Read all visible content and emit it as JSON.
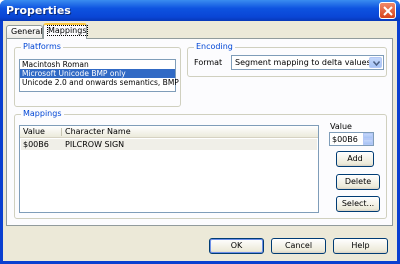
{
  "window": {
    "title": "Properties"
  },
  "tabs": [
    {
      "label": "General"
    },
    {
      "label": "Mappings"
    }
  ],
  "platforms": {
    "label": "Platforms",
    "items": [
      {
        "label": "Macintosh Roman"
      },
      {
        "label": "Microsoft Unicode BMP only"
      },
      {
        "label": "Unicode 2.0 and onwards semantics, BMP"
      }
    ],
    "selected_index": 1
  },
  "encoding": {
    "label": "Encoding",
    "format_label": "Format",
    "format_value": "Segment mapping to delta values"
  },
  "mappings": {
    "label": "Mappings",
    "columns": [
      "Value",
      "Character Name"
    ],
    "rows": [
      {
        "value": "$00B6",
        "name": "PILCROW SIGN"
      }
    ],
    "value_label": "Value",
    "value_input": "$00B6",
    "add_label": "Add",
    "delete_label": "Delete",
    "select_label": "Select..."
  },
  "buttons": {
    "ok": "OK",
    "cancel": "Cancel",
    "help": "Help"
  }
}
